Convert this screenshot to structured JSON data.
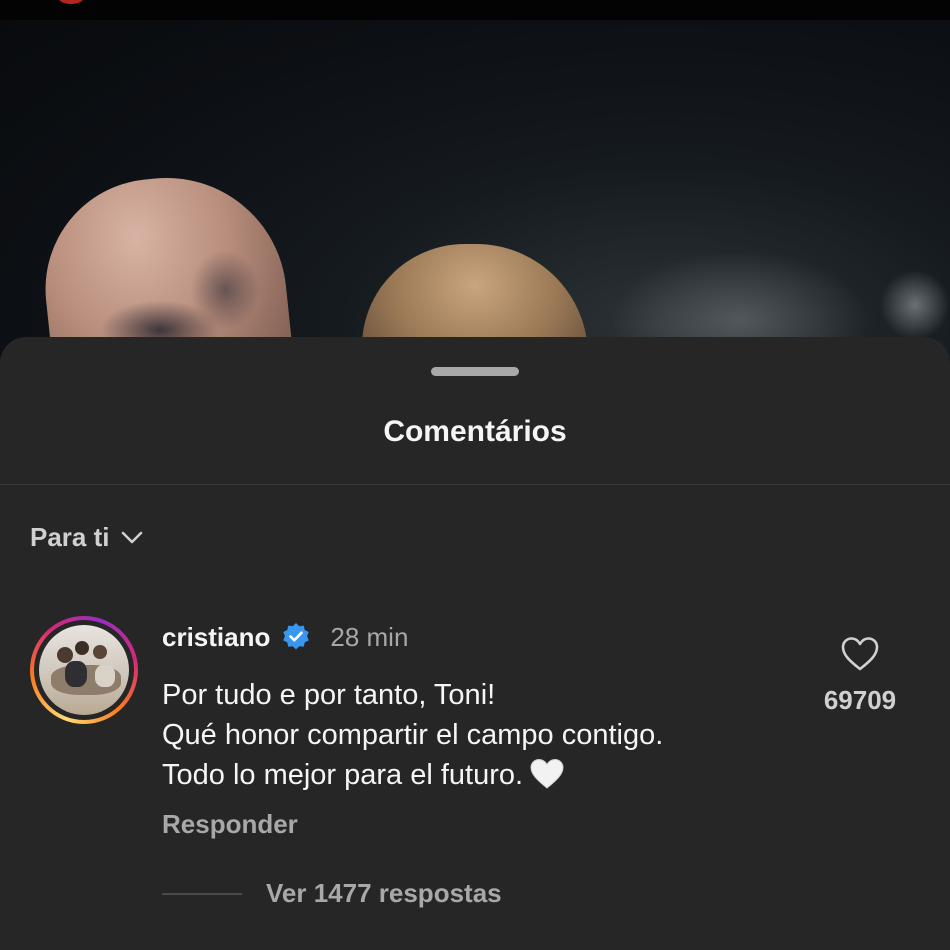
{
  "sheet": {
    "title": "Comentários",
    "sort_label": "Para ti"
  },
  "comment": {
    "username": "cristiano",
    "verified": true,
    "time": "28 min",
    "lines": [
      "Por tudo e por tanto, Toni!",
      "Qué honor compartir el campo contigo.",
      "Todo lo mejor para el futuro."
    ],
    "reply_label": "Responder",
    "like_count": "69709",
    "view_replies": "Ver 1477 respostas"
  },
  "icons": {
    "sort": "chevron-down-icon",
    "verified": "verified-badge-icon",
    "like": "heart-outline-icon",
    "emoji": "white-heart-emoji"
  },
  "colors": {
    "sheet_bg": "#262626",
    "verified_blue": "#3897f0",
    "primary_text": "#f5f5f5",
    "secondary_text": "#a8a8a8"
  }
}
